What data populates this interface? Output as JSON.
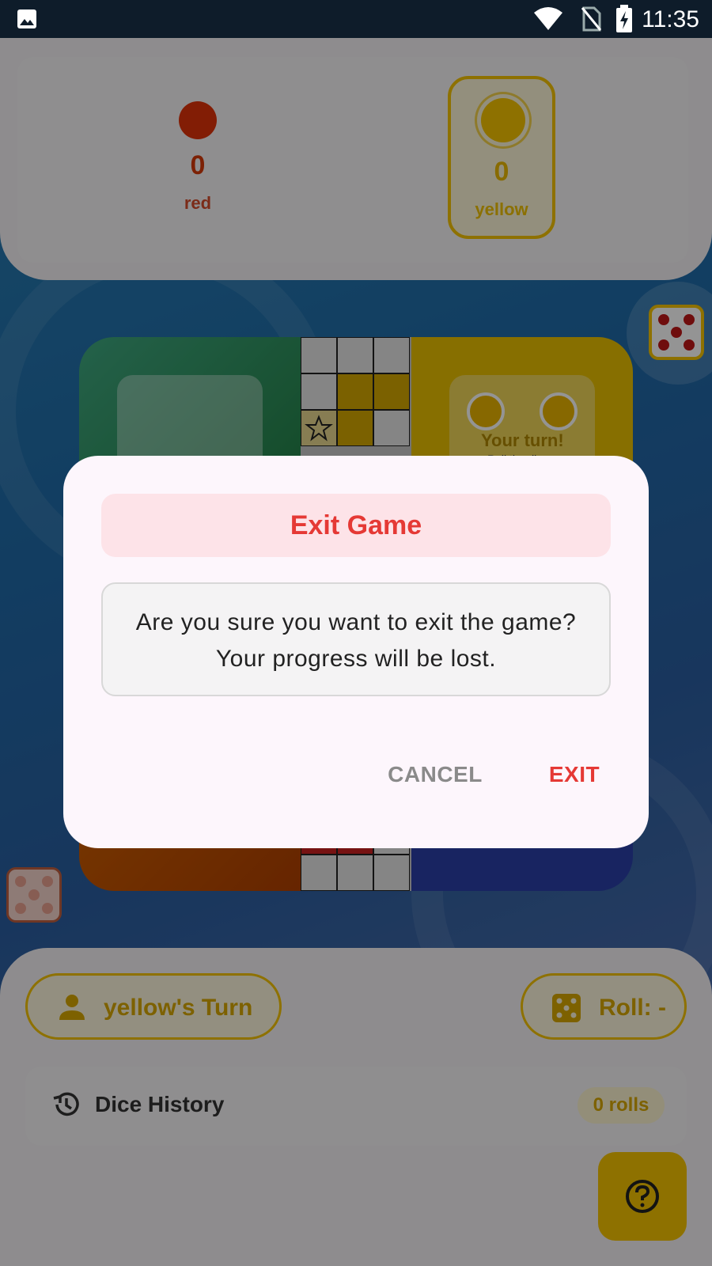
{
  "status_bar": {
    "time": "11:35",
    "icons": [
      "image-icon",
      "wifi-icon",
      "no-sim-icon",
      "battery-charging-icon"
    ]
  },
  "scoreboard": {
    "players": [
      {
        "name": "red",
        "score": "0",
        "color": "#e0320a"
      },
      {
        "name": "yellow",
        "score": "0",
        "color": "#f4c300",
        "active": true
      }
    ]
  },
  "board": {
    "turn_text": "Your turn!",
    "turn_subtext": "Roll the dice"
  },
  "bottom_panel": {
    "turn_label": "yellow's Turn",
    "roll_label": "Roll: -",
    "history_title": "Dice History",
    "rolls_badge": "0 rolls"
  },
  "dialog": {
    "title": "Exit Game",
    "message_line1": "Are you sure you want to exit the game?",
    "message_line2": "Your progress will be lost.",
    "cancel_label": "CANCEL",
    "exit_label": "EXIT",
    "accent_color": "#e53935"
  }
}
